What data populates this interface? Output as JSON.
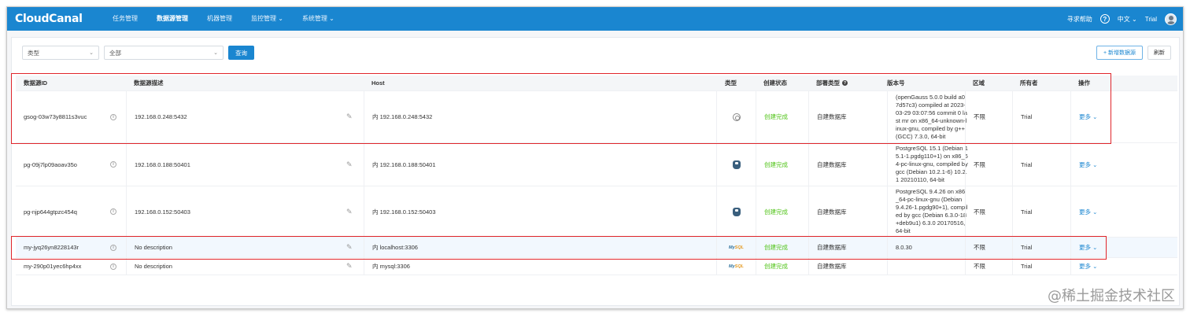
{
  "nav": {
    "logo": "CloudCanal",
    "items": [
      {
        "label": "任务管理"
      },
      {
        "label": "数据源管理"
      },
      {
        "label": "机器管理"
      },
      {
        "label": "监控管理 ⌄"
      },
      {
        "label": "系统管理 ⌄"
      }
    ],
    "help": "寻求帮助",
    "help_icon": "?",
    "language": "中文 ⌄",
    "user": "Trial"
  },
  "filters": {
    "type_select": "类型",
    "scope_select": "全部",
    "search_button": "查询",
    "chevron": "⌄"
  },
  "actions": {
    "add_button": "+ 新增数据源",
    "refresh_button": "刷新"
  },
  "table": {
    "columns": {
      "id": "数据源ID",
      "desc": "数据源描述",
      "host": "Host",
      "type": "类型",
      "status": "创建状态",
      "deploy": "部署类型",
      "version": "版本号",
      "region": "区域",
      "owner": "所有者",
      "ops": "操作"
    },
    "deploy_help_icon": "?",
    "info_icon": "i",
    "edit_icon": "✎",
    "rows": [
      {
        "id": "gsog-03w73y8811s3vuc",
        "desc": "192.168.0.248:5432",
        "host": "内 192.168.0.248:5432",
        "db_icon": "opengauss-icon",
        "status": "创建完成",
        "deploy": "自建数据库",
        "version": "(openGauss 5.0.0 build a07d57c3) compiled at 2023-03-29 03:07:56 commit 0 last mr on x86_64-unknown-linux-gnu, compiled by g++ (GCC) 7.3.0, 64-bit",
        "region": "不限",
        "owner": "Trial",
        "ops": "更多 ⌄"
      },
      {
        "id": "pg-09j7lp09aoav35o",
        "desc": "192.168.0.188:50401",
        "host": "内 192.168.0.188:50401",
        "db_icon": "postgresql-icon",
        "status": "创建完成",
        "deploy": "自建数据库",
        "version": "PostgreSQL 15.1 (Debian 15.1-1.pgdg110+1) on x86_64-pc-linux-gnu, compiled by gcc (Debian 10.2.1-6) 10.2.1 20210110, 64-bit",
        "region": "不限",
        "owner": "Trial",
        "ops": "更多 ⌄"
      },
      {
        "id": "pg-njp644gtpzc454q",
        "desc": "192.168.0.152:50403",
        "host": "内 192.168.0.152:50403",
        "db_icon": "postgresql-icon",
        "status": "创建完成",
        "deploy": "自建数据库",
        "version": "PostgreSQL 9.4.26 on x86_64-pc-linux-gnu (Debian 9.4.26-1.pgdg90+1), compiled by gcc (Debian 6.3.0-18+deb9u1) 6.3.0 20170516, 64-bit",
        "region": "不限",
        "owner": "Trial",
        "ops": "更多 ⌄"
      },
      {
        "id": "my-jyq26yn8228143r",
        "desc": "No description",
        "host": "内 localhost:3306",
        "db_icon": "mysql-icon",
        "status": "创建完成",
        "deploy": "自建数据库",
        "version": "8.0.30",
        "region": "不限",
        "owner": "Trial",
        "ops": "更多 ⌄"
      },
      {
        "id": "my-290p01yec6hp4xx",
        "desc": "No description",
        "host": "内 mysql:3306",
        "db_icon": "mysql-icon",
        "status": "创建完成",
        "deploy": "自建数据库",
        "version": "",
        "region": "不限",
        "owner": "Trial",
        "ops": "更多 ⌄"
      }
    ]
  },
  "mysql_logo": {
    "a": "My",
    "b": "SQL"
  },
  "watermark": "@稀土掘金技术社区"
}
